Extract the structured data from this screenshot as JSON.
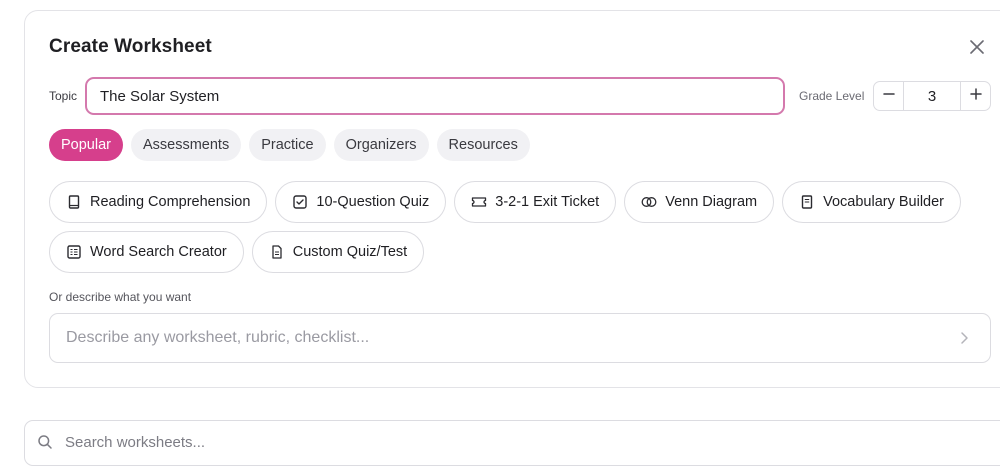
{
  "dialog": {
    "title": "Create Worksheet",
    "close_icon": "close-icon"
  },
  "topic": {
    "label": "Topic",
    "value": "The Solar System"
  },
  "grade": {
    "label": "Grade Level",
    "value": "3",
    "minus_icon": "minus-icon",
    "plus_icon": "plus-icon"
  },
  "tabs": [
    {
      "label": "Popular",
      "active": true
    },
    {
      "label": "Assessments",
      "active": false
    },
    {
      "label": "Practice",
      "active": false
    },
    {
      "label": "Organizers",
      "active": false
    },
    {
      "label": "Resources",
      "active": false
    }
  ],
  "templates": [
    {
      "label": "Reading Comprehension",
      "icon": "book-icon"
    },
    {
      "label": "10-Question Quiz",
      "icon": "checkbox-icon"
    },
    {
      "label": "3-2-1 Exit Ticket",
      "icon": "ticket-icon"
    },
    {
      "label": "Venn Diagram",
      "icon": "venn-icon"
    },
    {
      "label": "Vocabulary Builder",
      "icon": "notebook-icon"
    },
    {
      "label": "Word Search Creator",
      "icon": "grid-icon"
    },
    {
      "label": "Custom Quiz/Test",
      "icon": "document-icon"
    }
  ],
  "describe": {
    "label": "Or describe what you want",
    "placeholder": "Describe any worksheet, rubric, checklist...",
    "submit_icon": "chevron-right-icon"
  },
  "search": {
    "placeholder": "Search worksheets...",
    "icon": "search-icon"
  },
  "colors": {
    "accent": "#d63f8c",
    "input_focus_border": "#d479ad"
  }
}
